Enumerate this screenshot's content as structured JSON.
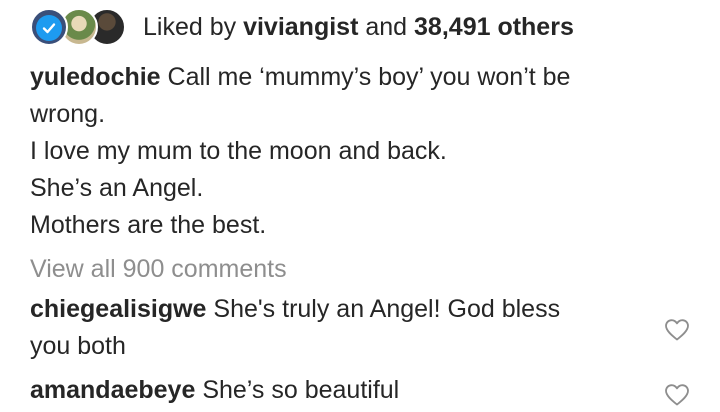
{
  "likes": {
    "prefix": "Liked by",
    "user": "viviangist",
    "connector": "and",
    "count_text": "38,491 others"
  },
  "caption": {
    "username": "yuledochie",
    "line1_text": "Call me ‘mummy’s boy’ you won’t be",
    "line2": "wrong.",
    "line3": "I love my mum to the moon and back.",
    "line4": "She’s an Angel.",
    "line5": "Mothers are the best."
  },
  "view_all_label": "View all 900 comments",
  "comments": [
    {
      "username": "chiegealisigwe",
      "line1_text": "She's truly an Angel! God bless",
      "line2": "you both"
    },
    {
      "username": "amandaebeye",
      "line1_text": "She’s so beautiful"
    }
  ],
  "icons": {
    "verified": "verified-badge-icon",
    "like": "heart-outline-icon"
  },
  "colors": {
    "text": "#262626",
    "muted": "#8e8e8e",
    "verified_blue": "#1d9bf0"
  }
}
